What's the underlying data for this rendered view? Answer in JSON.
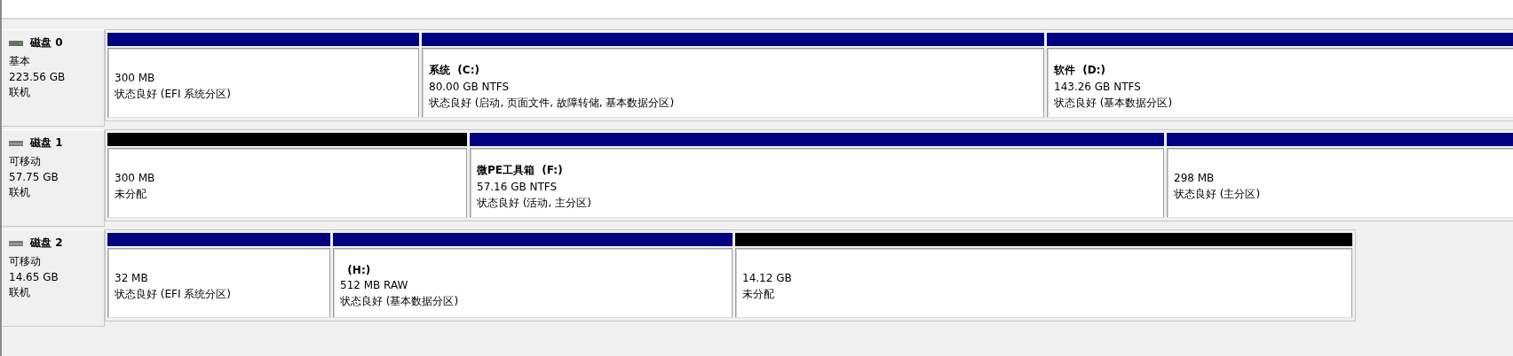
{
  "disks": [
    {
      "name": "磁盘 0",
      "kind": "fixed",
      "type": "基本",
      "size": "223.56 GB",
      "status": "联机",
      "partitions": [
        {
          "kind": "primary",
          "size": "300 MB",
          "status": "状态良好 (EFI 系统分区)"
        },
        {
          "kind": "primary",
          "label": "系统  (C:)",
          "size": "80.00 GB NTFS",
          "status": "状态良好 (启动, 页面文件, 故障转储, 基本数据分区)"
        },
        {
          "kind": "primary",
          "label": "软件  (D:)",
          "size": "143.26 GB NTFS",
          "status": "状态良好 (基本数据分区)"
        }
      ]
    },
    {
      "name": "磁盘 1",
      "kind": "removable",
      "type": "可移动",
      "size": "57.75 GB",
      "status": "联机",
      "partitions": [
        {
          "kind": "unallocated",
          "size": "300 MB",
          "status": "未分配"
        },
        {
          "kind": "primary",
          "label": "微PE工具箱  (F:)",
          "size": "57.16 GB NTFS",
          "status": "状态良好 (活动, 主分区)"
        },
        {
          "kind": "primary",
          "size": "298 MB",
          "status": "状态良好 (主分区)"
        }
      ]
    },
    {
      "name": "磁盘 2",
      "kind": "removable",
      "type": "可移动",
      "size": "14.65 GB",
      "status": "联机",
      "partitions": [
        {
          "kind": "primary",
          "size": "32 MB",
          "status": "状态良好 (EFI 系统分区)"
        },
        {
          "kind": "primary",
          "label": "  (H:)",
          "size": "512 MB RAW",
          "status": "状态良好 (基本数据分区)"
        },
        {
          "kind": "unallocated",
          "size": "14.12 GB",
          "status": "未分配"
        }
      ]
    }
  ]
}
